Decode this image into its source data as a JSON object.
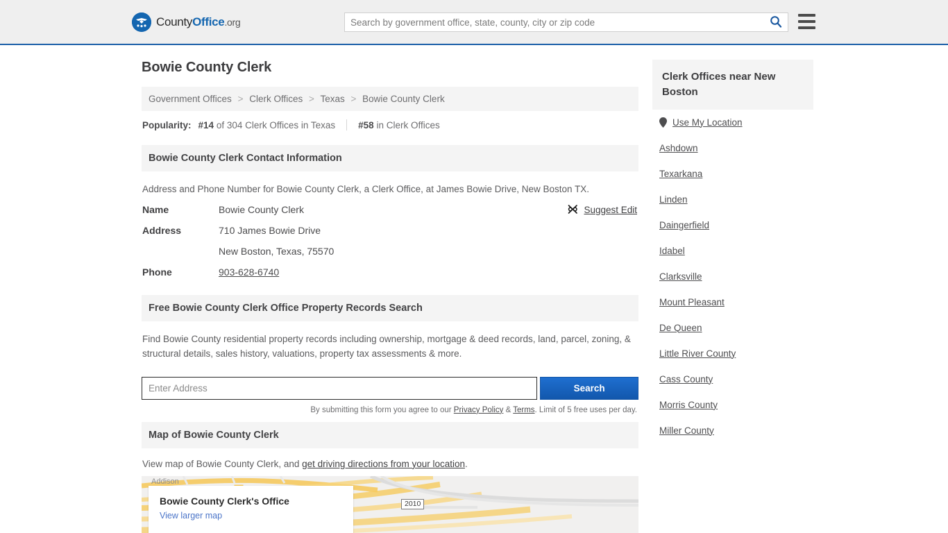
{
  "header": {
    "logo": {
      "icon": "eagle-shield-icon",
      "part1": "County",
      "part2": "Office",
      "part3": ".org"
    },
    "search": {
      "placeholder": "Search by government office, state, county, city or zip code",
      "value": "",
      "icon": "search-icon"
    },
    "menu_icon": "hamburger-menu-icon"
  },
  "main": {
    "page_title": "Bowie County Clerk",
    "breadcrumb": [
      "Government Offices",
      "Clerk Offices",
      "Texas",
      "Bowie County Clerk"
    ],
    "breadcrumb_separator": ">",
    "popularity": {
      "label": "Popularity:",
      "rank_state": "#14",
      "rank_state_text": "of 304 Clerk Offices in Texas",
      "rank_national": "#58",
      "rank_national_text": "in Clerk Offices"
    },
    "contact": {
      "heading": "Bowie County Clerk Contact Information",
      "intro": "Address and Phone Number for Bowie County Clerk, a Clerk Office, at James Bowie Drive, New Boston TX.",
      "rows": [
        {
          "key": "Name",
          "value": "Bowie County Clerk",
          "link": false
        },
        {
          "key": "Address",
          "value": "710 James Bowie Drive",
          "link": false
        },
        {
          "key": "",
          "value": "New Boston, Texas, 75570",
          "link": false
        },
        {
          "key": "Phone",
          "value": "903-628-6740",
          "link": true
        }
      ],
      "suggest_edit": {
        "label": "Suggest Edit",
        "icon": "edit-pencil-icon"
      }
    },
    "property_search": {
      "heading": "Free Bowie County Clerk Office Property Records Search",
      "description": "Find Bowie County residential property records including ownership, mortgage & deed records, land, parcel, zoning, & structural details, sales history, valuations, property tax assessments & more.",
      "input_placeholder": "Enter Address",
      "input_value": "",
      "button_label": "Search",
      "button_color": "#1a63bd",
      "disclaimer_prefix": "By submitting this form you agree to our ",
      "disclaimer_privacy": "Privacy Policy",
      "disclaimer_amp": " & ",
      "disclaimer_terms": "Terms",
      "disclaimer_suffix": ". Limit of 5 free uses per day."
    },
    "map_section": {
      "heading": "Map of Bowie County Clerk",
      "intro_prefix": "View map of Bowie County Clerk, and ",
      "intro_link": "get driving directions from your location",
      "intro_suffix": ".",
      "card_title": "Bowie County Clerk's Office",
      "card_link": "View larger map",
      "label_addison": "Addison",
      "route_shield": "2010"
    }
  },
  "sidebar": {
    "heading": "Clerk Offices near New Boston",
    "use_my_location": {
      "label": "Use My Location",
      "icon": "map-pin-icon"
    },
    "items": [
      {
        "label": "Ashdown"
      },
      {
        "label": "Texarkana"
      },
      {
        "label": "Linden"
      },
      {
        "label": "Daingerfield"
      },
      {
        "label": "Idabel"
      },
      {
        "label": "Clarksville"
      },
      {
        "label": "Mount Pleasant"
      },
      {
        "label": "De Queen"
      },
      {
        "label": "Little River County"
      },
      {
        "label": "Cass County"
      },
      {
        "label": "Morris County"
      },
      {
        "label": "Miller County"
      }
    ]
  }
}
